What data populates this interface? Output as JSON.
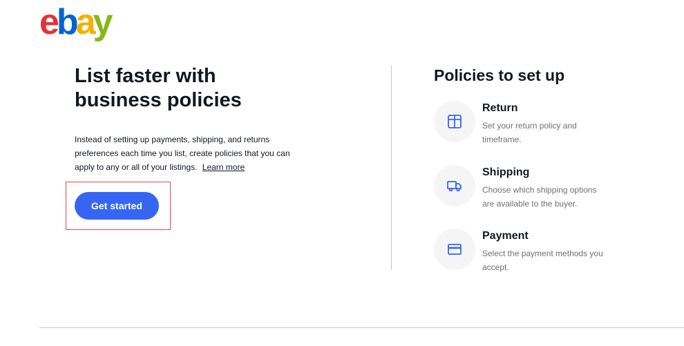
{
  "brand": {
    "logo_letters": [
      "e",
      "b",
      "a",
      "y"
    ],
    "colors": {
      "e": "#e53238",
      "b": "#0064d2",
      "a": "#f5af02",
      "y": "#86b817"
    }
  },
  "intro": {
    "headline": "List faster with business policies",
    "body": "Instead of setting up payments, shipping, and returns preferences each time you list, create policies that you can apply to any or all of your listings.",
    "learn_more_label": "Learn more",
    "cta_label": "Get started",
    "cta_color": "#3665f3"
  },
  "policies": {
    "title": "Policies to set up",
    "items": [
      {
        "title": "Return",
        "description": "Set your return policy and timeframe.",
        "icon": "box-icon"
      },
      {
        "title": "Shipping",
        "description": "Choose which shipping options are available to the buyer.",
        "icon": "truck-icon"
      },
      {
        "title": "Payment",
        "description": "Select the payment methods you accept.",
        "icon": "credit-card-icon"
      }
    ]
  }
}
